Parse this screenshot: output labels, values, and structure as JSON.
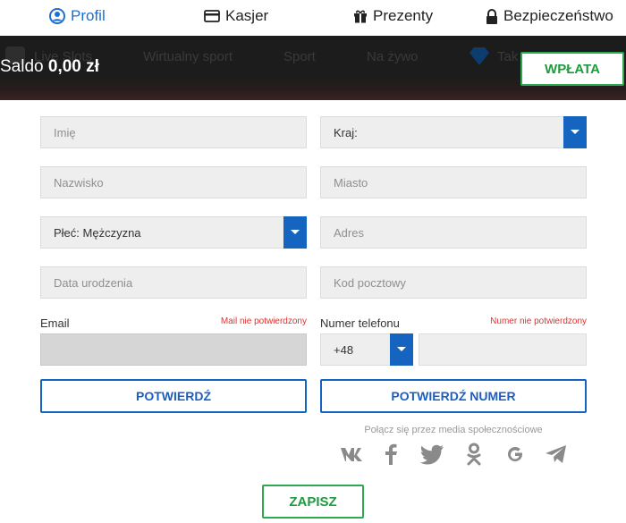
{
  "tabs": [
    {
      "label": "Profil",
      "icon": "user-circle-icon",
      "active": true
    },
    {
      "label": "Kasjer",
      "icon": "card-icon"
    },
    {
      "label": "Prezenty",
      "icon": "gift-icon"
    },
    {
      "label": "Bezpieczeństwo",
      "icon": "lock-icon"
    }
  ],
  "band": {
    "nav": [
      "Live Slots",
      "Wirtualny sport",
      "Sport",
      "Na żywo",
      "Tak"
    ],
    "saldo_label": "Saldo",
    "saldo_value": "0,00 zł",
    "deposit_label": "WPŁATA"
  },
  "form": {
    "first_name_placeholder": "Imię",
    "last_name_placeholder": "Nazwisko",
    "gender_value": "Płeć: Mężczyzna",
    "birthdate_placeholder": "Data urodzenia",
    "country_value": "Kraj:",
    "city_placeholder": "Miasto",
    "address_placeholder": "Adres",
    "postal_placeholder": "Kod pocztowy",
    "email_label": "Email",
    "email_error": "Mail nie potwierdzony",
    "phone_label": "Numer telefonu",
    "phone_error": "Numer nie potwierdzony",
    "phone_prefix": "+48",
    "confirm_label": "POTWIERDŹ",
    "confirm_number_label": "POTWIERDŹ NUMER",
    "social_text": "Połącz się przez media społecznościowe",
    "social_icons": [
      "vk-icon",
      "facebook-icon",
      "twitter-icon",
      "odnoklassniki-icon",
      "google-icon",
      "telegram-icon"
    ],
    "save_label": "ZAPISZ"
  },
  "colors": {
    "accent_blue": "#1565c0",
    "accent_green": "#2fa84f",
    "error_red": "#e03030"
  }
}
